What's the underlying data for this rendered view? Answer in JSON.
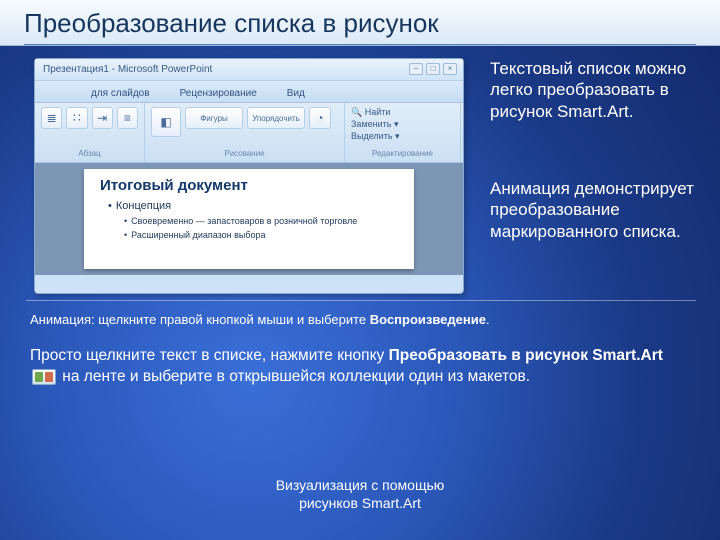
{
  "title": "Преобразование списка в рисунок",
  "screenshot": {
    "window_title": "Презентация1 - Microsoft PowerPoint",
    "tabs": {
      "t1": "для слайдов",
      "t2": "Рецензирование",
      "t3": "Вид"
    },
    "groups": {
      "g1": "Абзац",
      "g2_btn_shapes": "Фигуры",
      "g2_btn_arrange": "Упорядочить",
      "g2": "Рисование",
      "g3_find": "Найти",
      "g3_replace": "Заменить ▾",
      "g3_select": "Выделить ▾",
      "g3": "Редактирование"
    },
    "slide": {
      "heading": "Итоговый документ",
      "b1": "Концепция",
      "b2a": "Своевременно — запастоваров в розничной торговле",
      "b2b": "Расширенный диапазон выбора"
    }
  },
  "right": {
    "p1": "Текстовый список можно легко преобразовать в рисунок Smart.Art.",
    "p2": "Анимация демонстрирует преобразование маркированного списка."
  },
  "anim_prefix": "Анимация: щелкните правой кнопкой мыши и выберите ",
  "anim_bold": "Воспроизведение",
  "anim_suffix": ".",
  "body2_a": "Просто щелкните текст в списке, нажмите кнопку ",
  "body2_b": "Преобразовать в рисунок Smart.Art",
  "body2_c": " на ленте и выберите в открывшейся коллекции один из макетов.",
  "footer1": "Визуализация с помощью",
  "footer2": "рисунков Smart.Art"
}
